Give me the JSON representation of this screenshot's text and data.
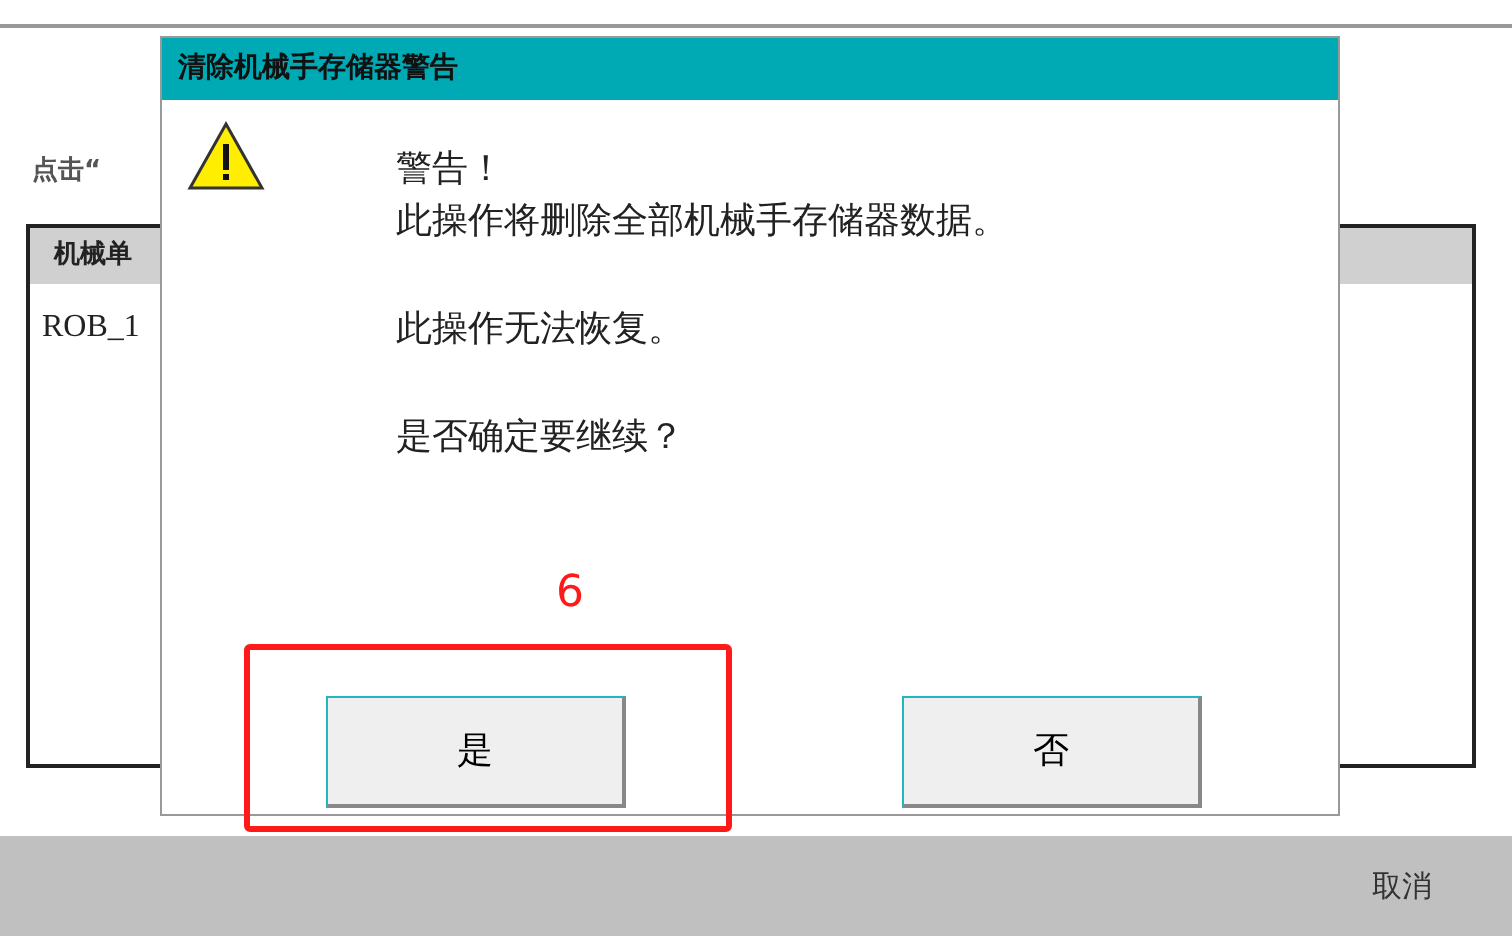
{
  "background_window": {
    "instruction": "点击“",
    "table": {
      "columns": [
        "机械单"
      ],
      "rows": [
        [
          "ROB_1"
        ]
      ]
    },
    "footer_button": "取消"
  },
  "dialog": {
    "title": "清除机械手存储器警告",
    "heading": "警告！",
    "lines": [
      "此操作将删除全部机械手存储器数据。",
      "此操作无法恢复。",
      "是否确定要继续？"
    ],
    "buttons": [
      {
        "label": "是"
      },
      {
        "label": "否"
      }
    ]
  },
  "annotation": {
    "label": "6"
  }
}
